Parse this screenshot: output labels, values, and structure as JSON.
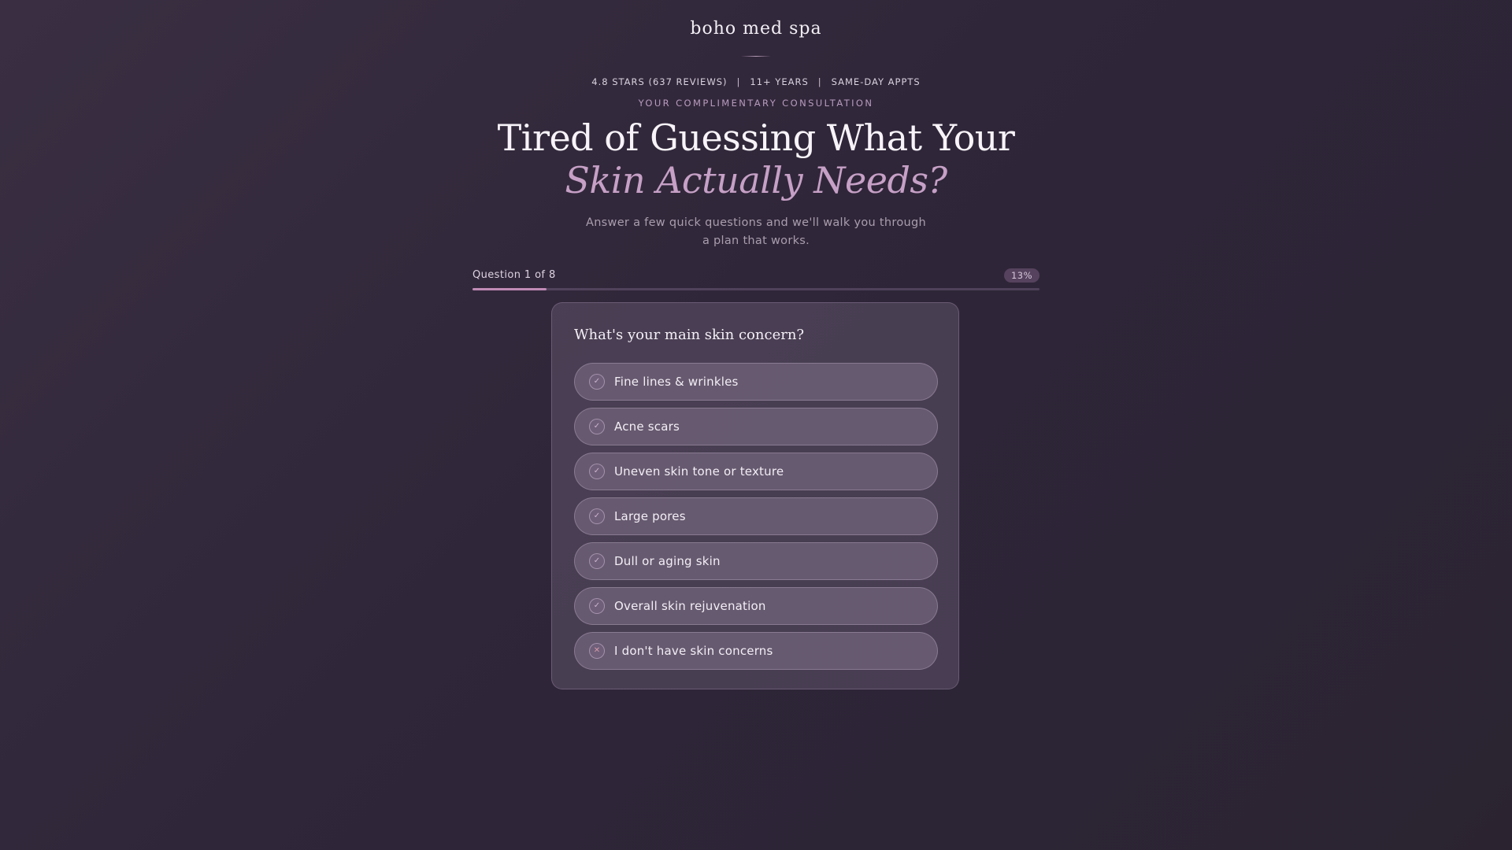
{
  "brand": {
    "name": "boho med spa"
  },
  "trust_bar": {
    "rating": "4.8 STARS (637 REVIEWS)",
    "years": "11+ YEARS",
    "appointments": "SAME-DAY APPTS",
    "separator": "|"
  },
  "hero": {
    "eyebrow": "YOUR COMPLIMENTARY CONSULTATION",
    "headline": "Tired of Guessing What Your",
    "headline_accent": "Skin Actually Needs?",
    "subtitle": "Answer a few quick questions and we'll walk you through a plan that works."
  },
  "progress": {
    "label": "Question 1 of 8",
    "percent_label": "13%",
    "fraction": 0.13
  },
  "quiz": {
    "question": "What's your main skin concern?",
    "options": [
      {
        "label": "Fine lines & wrinkles",
        "icon": "check-icon",
        "glyph": "✓"
      },
      {
        "label": "Acne scars",
        "icon": "check-icon",
        "glyph": "✓"
      },
      {
        "label": "Uneven skin tone or texture",
        "icon": "check-icon",
        "glyph": "✓"
      },
      {
        "label": "Large pores",
        "icon": "check-icon",
        "glyph": "✓"
      },
      {
        "label": "Dull or aging skin",
        "icon": "check-icon",
        "glyph": "✓"
      },
      {
        "label": "Overall skin rejuvenation",
        "icon": "check-icon",
        "glyph": "✓"
      },
      {
        "label": "I don't have skin concerns",
        "icon": "x-icon",
        "glyph": "✕"
      }
    ]
  },
  "colors": {
    "accent": "#c6a0c6",
    "progress_fill": "#c08bb6",
    "background": "#2f2639"
  }
}
